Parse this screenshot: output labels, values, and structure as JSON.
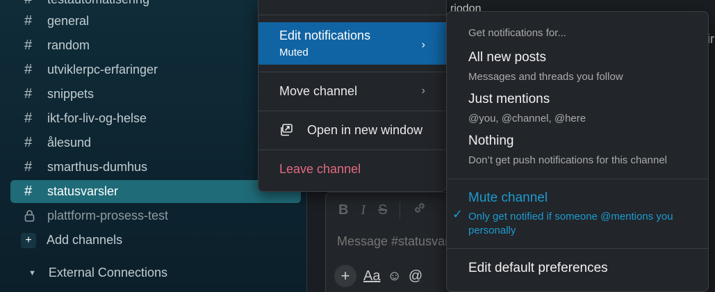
{
  "sidebar": {
    "channels": [
      {
        "prefix": "#",
        "name": "testautomatisering",
        "state": "normal"
      },
      {
        "prefix": "#",
        "name": "general",
        "state": "normal"
      },
      {
        "prefix": "#",
        "name": "random",
        "state": "normal"
      },
      {
        "prefix": "#",
        "name": "utviklerpc-erfaringer",
        "state": "normal"
      },
      {
        "prefix": "#",
        "name": "snippets",
        "state": "normal"
      },
      {
        "prefix": "#",
        "name": "ikt-for-liv-og-helse",
        "state": "normal"
      },
      {
        "prefix": "#",
        "name": "ålesund",
        "state": "normal"
      },
      {
        "prefix": "#",
        "name": "smarthus-dumhus",
        "state": "normal"
      },
      {
        "prefix": "#",
        "name": "statusvarsler",
        "state": "active"
      },
      {
        "prefix": "lock-icon",
        "name": "plattform-prosess-test",
        "state": "muted"
      }
    ],
    "add_channels_label": "Add channels",
    "section_label": "External Connections"
  },
  "main": {
    "top_text": "riodon",
    "edge_text": "ir",
    "composer": {
      "placeholder": "Message #statusvarsler",
      "format_icons": [
        "bold-icon",
        "italic-icon",
        "strikethrough-icon",
        "link-icon"
      ],
      "bottom_icons": [
        "plus-icon",
        "text-format-icon",
        "emoji-icon",
        "mention-icon"
      ],
      "aa_label": "Aa"
    }
  },
  "context_menu": {
    "edit_notifications": {
      "label": "Edit notifications",
      "sublabel": "Muted"
    },
    "move_channel": {
      "label": "Move channel"
    },
    "open_new_window": {
      "label": "Open in new window"
    },
    "leave_channel": {
      "label": "Leave channel"
    }
  },
  "notifications_submenu": {
    "header": "Get notifications for...",
    "options": [
      {
        "title": "All new posts",
        "description": "Messages and threads you follow"
      },
      {
        "title": "Just mentions",
        "description": "@you, @channel, @here"
      },
      {
        "title": "Nothing",
        "description": "Don’t get push notifications for this channel"
      }
    ],
    "mute": {
      "title": "Mute channel",
      "description": "Only get notified if someone @mentions you personally",
      "checked": true
    },
    "edit_default": "Edit default preferences"
  },
  "colors": {
    "sidebar_bg": "#0f2c38",
    "active_channel": "#1f6b78",
    "menu_highlight": "#1164a3",
    "danger": "#e16a82",
    "selected_accent": "#1d9bd1"
  }
}
